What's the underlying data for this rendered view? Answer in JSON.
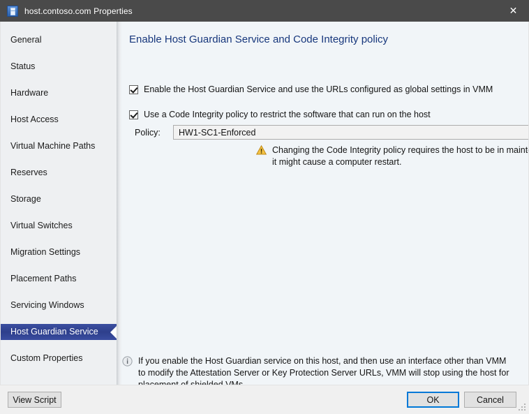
{
  "window": {
    "title": "host.contoso.com Properties",
    "icon": "server-properties-icon",
    "close_label": "✕"
  },
  "sidebar": {
    "items": [
      {
        "label": "General",
        "selected": false
      },
      {
        "label": "Status",
        "selected": false
      },
      {
        "label": "Hardware",
        "selected": false
      },
      {
        "label": "Host Access",
        "selected": false
      },
      {
        "label": "Virtual Machine Paths",
        "selected": false
      },
      {
        "label": "Reserves",
        "selected": false
      },
      {
        "label": "Storage",
        "selected": false
      },
      {
        "label": "Virtual Switches",
        "selected": false
      },
      {
        "label": "Migration Settings",
        "selected": false
      },
      {
        "label": "Placement Paths",
        "selected": false
      },
      {
        "label": "Servicing Windows",
        "selected": false
      },
      {
        "label": "Host Guardian Service",
        "selected": true
      },
      {
        "label": "Custom Properties",
        "selected": false
      }
    ]
  },
  "content": {
    "title": "Enable Host Guardian Service and Code Integrity policy",
    "checkbox_hgs": {
      "label": "Enable the Host Guardian Service and use the URLs configured as global settings in VMM",
      "checked": true
    },
    "checkbox_ci": {
      "label": "Use a Code Integrity policy to restrict the software that can run on the host",
      "checked": true
    },
    "policy": {
      "label": "Policy:",
      "value": "HW1-SC1-Enforced",
      "arrow": "⌄"
    },
    "warning": {
      "icon": "warning-triangle-icon",
      "text": "Changing the Code Integrity policy requires the host to be in maintenance mode and it might cause a computer restart."
    },
    "info": {
      "icon": "information-icon",
      "text": "If you enable the Host Guardian service on this host, and then use an interface other than VMM to modify the Attestation Server or Key Protection Server URLs, VMM will stop using the host for placement of shielded VMs."
    }
  },
  "footer": {
    "view_script_label": "View Script",
    "ok_label": "OK",
    "cancel_label": "Cancel"
  },
  "colors": {
    "titlebar_bg": "#4a4a4a",
    "selected_nav_bg": "#2e3f8c",
    "heading_text": "#17377c",
    "focus_border": "#0078d7",
    "warning_amber": "#f0b429",
    "content_bg": "#f1f5f8",
    "sidebar_bg": "#eef0f2"
  }
}
